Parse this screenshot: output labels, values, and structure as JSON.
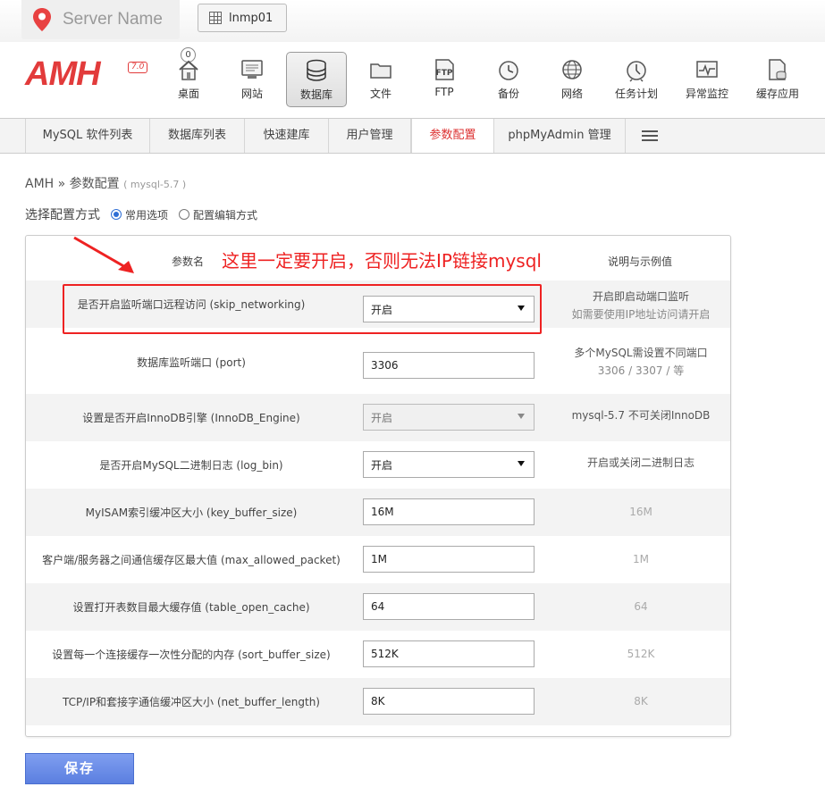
{
  "server": {
    "name": "Server Name",
    "host": "lnmp01"
  },
  "logo": {
    "text": "AMH",
    "version": "7.0"
  },
  "toolbar": {
    "badge": "0",
    "items": [
      {
        "label": "桌面",
        "icon": "home-icon"
      },
      {
        "label": "网站",
        "icon": "monitor-icon"
      },
      {
        "label": "数据库",
        "icon": "database-icon"
      },
      {
        "label": "文件",
        "icon": "folder-icon"
      },
      {
        "label": "FTP",
        "icon": "ftp-icon"
      },
      {
        "label": "备份",
        "icon": "clock-icon"
      },
      {
        "label": "网络",
        "icon": "globe-icon"
      },
      {
        "label": "任务计划",
        "icon": "alarm-icon"
      },
      {
        "label": "异常监控",
        "icon": "pulse-icon"
      },
      {
        "label": "缓存应用",
        "icon": "cache-icon"
      }
    ],
    "ftp_glyph": "FTP"
  },
  "subnav": {
    "tabs": [
      {
        "label": "MySQL 软件列表"
      },
      {
        "label": "数据库列表"
      },
      {
        "label": "快速建库"
      },
      {
        "label": "用户管理"
      },
      {
        "label": "参数配置"
      },
      {
        "label": "phpMyAdmin 管理"
      }
    ]
  },
  "breadcrumb": {
    "root": "AMH",
    "sep": "»",
    "page": "参数配置",
    "sub": "( mysql-5.7 )"
  },
  "mode": {
    "label": "选择配置方式",
    "option1": "常用选项",
    "option2": "配置编辑方式"
  },
  "table": {
    "col_name": "参数名",
    "col_desc": "说明与示例值",
    "rows": [
      {
        "name": "是否开启监听端口远程访问 (skip_networking)",
        "value": "开启",
        "type": "select",
        "desc1": "开启即启动端口监听",
        "desc2": "如需要使用IP地址访问请开启"
      },
      {
        "name": "数据库监听端口 (port)",
        "value": "3306",
        "type": "input",
        "desc1": "多个MySQL需设置不同端口",
        "desc2": "3306 / 3307 / 等"
      },
      {
        "name": "设置是否开启InnoDB引擎 (InnoDB_Engine)",
        "value": "开启",
        "type": "select-disabled",
        "desc1": "mysql-5.7 不可关闭InnoDB",
        "desc2": ""
      },
      {
        "name": "是否开启MySQL二进制日志 (log_bin)",
        "value": "开启",
        "type": "select",
        "desc1": "开启或关闭二进制日志",
        "desc2": ""
      },
      {
        "name": "MyISAM索引缓冲区大小 (key_buffer_size)",
        "value": "16M",
        "type": "input",
        "desc1": "16M",
        "desc2": ""
      },
      {
        "name": "客户端/服务器之间通信缓存区最大值 (max_allowed_packet)",
        "value": "1M",
        "type": "input",
        "desc1": "1M",
        "desc2": ""
      },
      {
        "name": "设置打开表数目最大缓存值 (table_open_cache)",
        "value": "64",
        "type": "input",
        "desc1": "64",
        "desc2": ""
      },
      {
        "name": "设置每一个连接缓存一次性分配的内存 (sort_buffer_size)",
        "value": "512K",
        "type": "input",
        "desc1": "512K",
        "desc2": ""
      },
      {
        "name": "TCP/IP和套接字通信缓冲区大小 (net_buffer_length)",
        "value": "8K",
        "type": "input",
        "desc1": "8K",
        "desc2": ""
      }
    ]
  },
  "annotation": {
    "text": "这里一定要开启，否则无法IP链接mysql",
    "color": "#ee2222"
  },
  "save_label": "保存",
  "colors": {
    "accent_red": "#dd3333",
    "button_blue": "#5b7fe0"
  }
}
